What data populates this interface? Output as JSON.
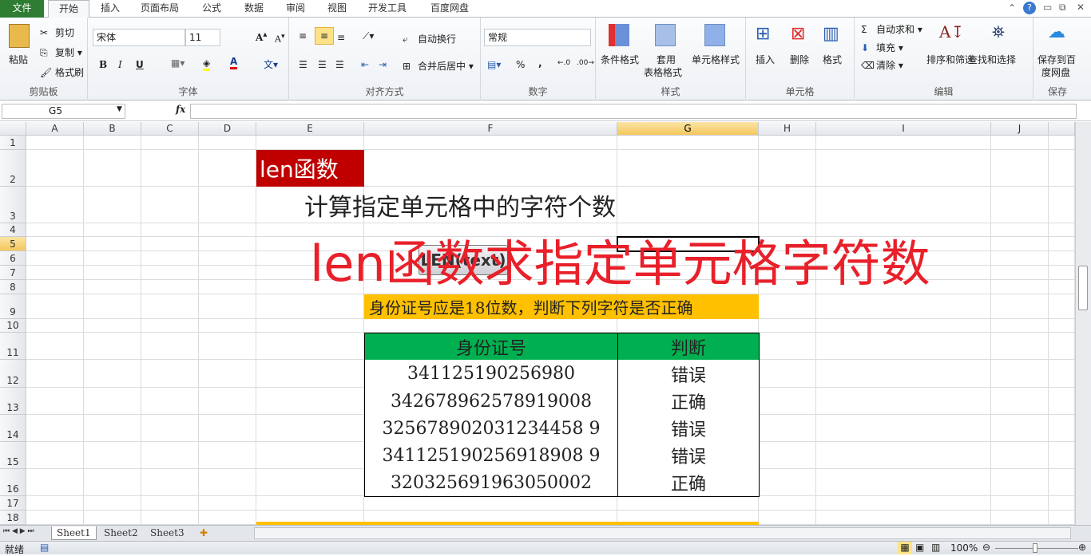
{
  "tabs": [
    "文件",
    "开始",
    "插入",
    "页面布局",
    "公式",
    "数据",
    "审阅",
    "视图",
    "开发工具",
    "百度网盘"
  ],
  "ribbon": {
    "clipboard": {
      "paste": "粘贴",
      "cut": "剪切",
      "copy": "复制",
      "format_painter": "格式刷",
      "label": "剪贴板"
    },
    "font": {
      "name": "宋体",
      "size": "11",
      "bold": "B",
      "italic": "I",
      "underline": "U",
      "label": "字体"
    },
    "alignment": {
      "wrap": "自动换行",
      "merge": "合并后居中",
      "label": "对齐方式"
    },
    "number": {
      "format": "常规",
      "percent": "%",
      "comma": ",",
      "label": "数字"
    },
    "styles": {
      "conditional": "条件格式",
      "table": "套用",
      "table2": "表格格式",
      "cell_styles": "单元格样式",
      "label": "样式"
    },
    "cells": {
      "insert": "插入",
      "delete": "删除",
      "format": "格式",
      "label": "单元格"
    },
    "editing": {
      "autosum": "自动求和",
      "fill": "填充",
      "clear": "清除",
      "sort": "排序和筛选",
      "find": "查找和选择",
      "label": "编辑"
    },
    "save": {
      "save": "保存到百",
      "save2": "度网盘",
      "label": "保存"
    }
  },
  "formula_bar": {
    "name_box": "G5",
    "fx": "fx",
    "value": ""
  },
  "columns": [
    "A",
    "B",
    "C",
    "D",
    "E",
    "F",
    "G",
    "H",
    "I",
    "J"
  ],
  "rows": [
    "1",
    "2",
    "3",
    "4",
    "5",
    "6",
    "7",
    "8",
    "9",
    "10",
    "11",
    "12",
    "13",
    "14",
    "15",
    "16",
    "17",
    "18"
  ],
  "content": {
    "title": "len函数",
    "subtitle": "计算指定单元格中的字符个数",
    "overlay": "len函数求指定单元格字符数",
    "button_text": "LEN(text)",
    "note": "身份证号应是18位数，判断下列字符是否正确",
    "table": {
      "headers": [
        "身份证号",
        "判断"
      ],
      "rows": [
        [
          "341125190256980",
          "错误"
        ],
        [
          "342678962578919008",
          "正确"
        ],
        [
          "325678902031234458 9",
          "错误"
        ],
        [
          "341125190256918908 9",
          "错误"
        ],
        [
          "320325691963050002",
          "正确"
        ]
      ]
    }
  },
  "sheets": [
    "Sheet1",
    "Sheet2",
    "Sheet3"
  ],
  "status": {
    "ready": "就绪",
    "zoom": "100%"
  },
  "colors": {
    "title_bg": "#c00000",
    "note_bg": "#ffc000",
    "header_bg": "#00b050",
    "overlay": "#e8202a"
  }
}
